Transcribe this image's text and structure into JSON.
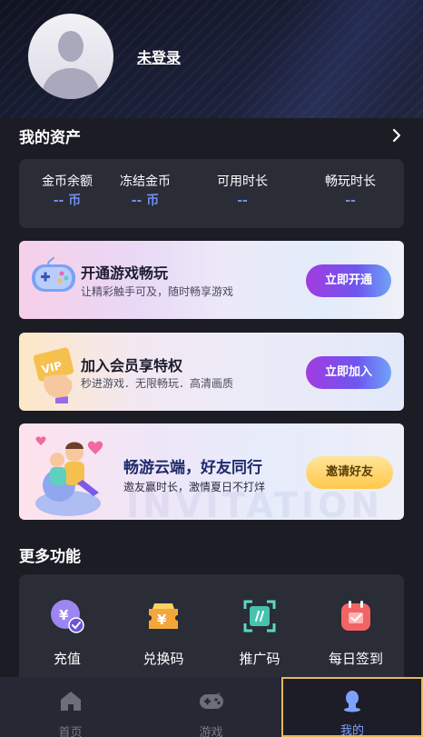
{
  "profile": {
    "username": "未登录"
  },
  "assets": {
    "title": "我的资产",
    "items": [
      {
        "label": "金币余额",
        "value": "-- 币"
      },
      {
        "label": "冻结金币",
        "value": "-- 币"
      },
      {
        "label": "可用时长",
        "value": "--"
      },
      {
        "label": "畅玩时长",
        "value": "--"
      }
    ]
  },
  "promos": [
    {
      "title": "开通游戏畅玩",
      "subtitle": "让精彩触手可及，随时畅享游戏",
      "button": "立即开通"
    },
    {
      "title": "加入会员享特权",
      "subtitle": "秒进游戏．无限畅玩．高清画质",
      "button": "立即加入"
    },
    {
      "title": "畅游云端，好友同行",
      "subtitle": "邀友赢时长，激情夏日不打烊",
      "button": "邀请好友",
      "watermark": "INVITATION"
    }
  ],
  "more": {
    "title": "更多功能",
    "items": [
      {
        "label": "充值",
        "icon": "recharge-icon"
      },
      {
        "label": "兑换码",
        "icon": "voucher-icon"
      },
      {
        "label": "推广码",
        "icon": "promo-code-icon"
      },
      {
        "label": "每日签到",
        "icon": "calendar-checkin-icon"
      }
    ]
  },
  "tabs": [
    {
      "label": "首页",
      "icon": "home-icon"
    },
    {
      "label": "游戏",
      "icon": "gamepad-icon"
    },
    {
      "label": "我的",
      "icon": "profile-icon",
      "active": true
    }
  ],
  "colors": {
    "accent": "#6e8eef",
    "active_tab_border": "#e8b660",
    "background": "#1b1c24"
  }
}
